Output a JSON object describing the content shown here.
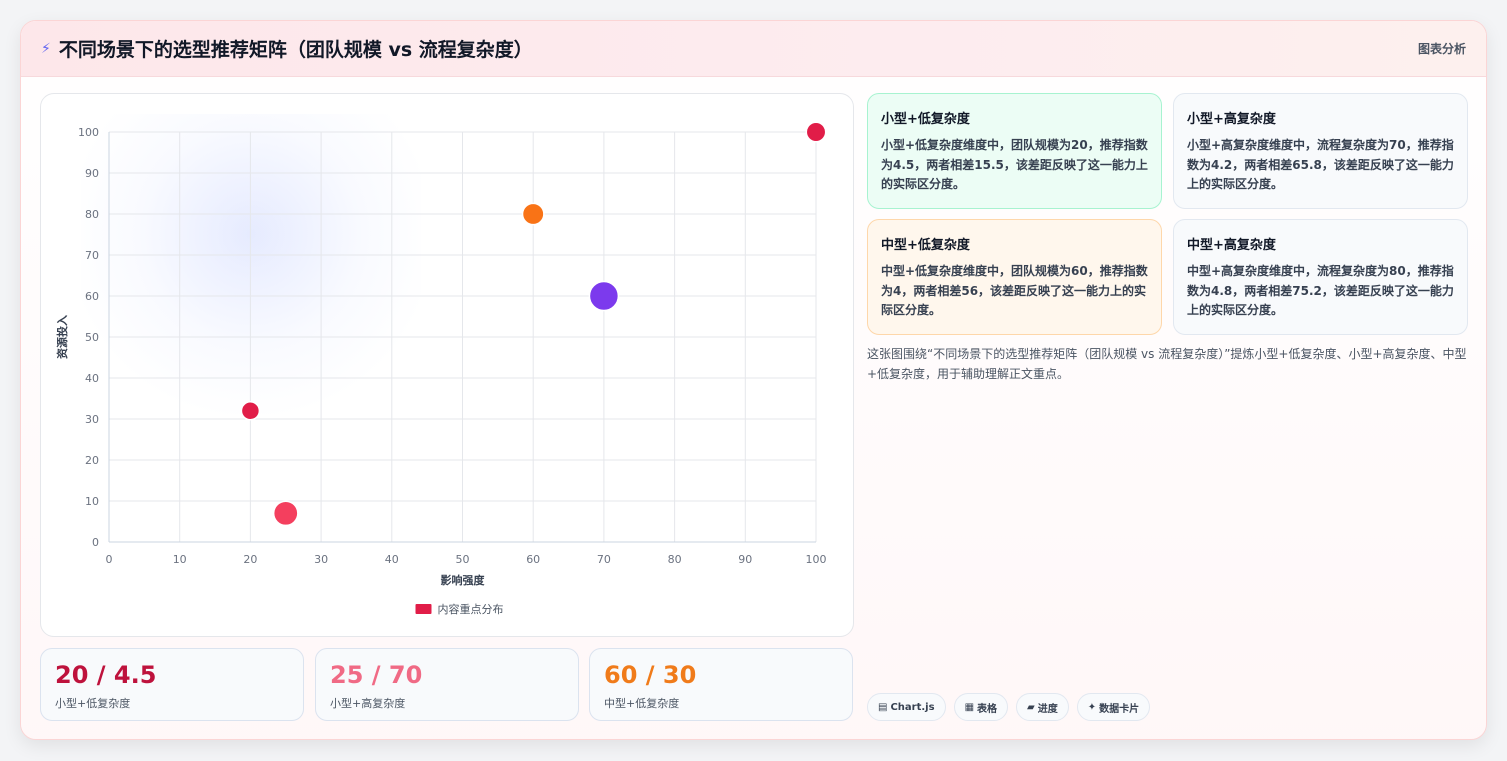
{
  "header": {
    "icon": "lightning-icon",
    "title": "不同场景下的选型推荐矩阵（团队规模 vs 流程复杂度）",
    "tag": "图表分析"
  },
  "chart_data": {
    "type": "scatter",
    "title": "",
    "xlabel": "影响强度",
    "ylabel": "资源投入",
    "xlim": [
      0,
      100
    ],
    "ylim": [
      0,
      100
    ],
    "x_ticks": [
      "0",
      "10",
      "20",
      "30",
      "40",
      "50",
      "60",
      "70",
      "80",
      "90",
      "100"
    ],
    "y_ticks": [
      "0",
      "10",
      "20",
      "30",
      "40",
      "50",
      "60",
      "70",
      "80",
      "90",
      "100"
    ],
    "grid": true,
    "legend": {
      "position": "bottom",
      "label": "内容重点分布",
      "color": "#e11d48"
    },
    "points": [
      {
        "x": 20,
        "y": 32,
        "size": 1,
        "color": "#e11d48"
      },
      {
        "x": 25,
        "y": 7,
        "size": 2,
        "color": "#f43f5e"
      },
      {
        "x": 60,
        "y": 80,
        "size": 1.5,
        "color": "#f97316"
      },
      {
        "x": 70,
        "y": 60,
        "size": 3,
        "color": "#7c3aed"
      },
      {
        "x": 100,
        "y": 100,
        "size": 1.2,
        "color": "#e11d48"
      }
    ]
  },
  "stats": [
    {
      "value": "20 / 4.5",
      "label": "小型+低复杂度",
      "color": "#be123c"
    },
    {
      "value": "25 / 70",
      "label": "小型+高复杂度",
      "color": "#f06a85"
    },
    {
      "value": "60 / 30",
      "label": "中型+低复杂度",
      "color": "#f07b1a"
    }
  ],
  "insights": [
    {
      "title": "小型+低复杂度",
      "text": "小型+低复杂度维度中，团队规模为20，推荐指数为4.5，两者相差15.5，该差距反映了这一能力上的实际区分度。",
      "bg": "#ecfdf5",
      "border": "#a7f3d0"
    },
    {
      "title": "小型+高复杂度",
      "text": "小型+高复杂度维度中，流程复杂度为70，推荐指数为4.2，两者相差65.8，该差距反映了这一能力上的实际区分度。",
      "bg": "#f8fafc",
      "border": "#e2e8f0"
    },
    {
      "title": "中型+低复杂度",
      "text": "中型+低复杂度维度中，团队规模为60，推荐指数为4，两者相差56，该差距反映了这一能力上的实际区分度。",
      "bg": "#fff7ed",
      "border": "#fed7aa"
    },
    {
      "title": "中型+高复杂度",
      "text": "中型+高复杂度维度中，流程复杂度为80，推荐指数为4.8，两者相差75.2，该差距反映了这一能力上的实际区分度。",
      "bg": "#f8fafc",
      "border": "#e2e8f0"
    }
  ],
  "summary": "这张图围绕“不同场景下的选型推荐矩阵（团队规模 vs 流程复杂度）”提炼小型+低复杂度、小型+高复杂度、中型+低复杂度，用于辅助理解正文重点。",
  "pills": [
    {
      "icon": "chart-icon",
      "glyph": "▤",
      "label": "Chart.js"
    },
    {
      "icon": "table-icon",
      "glyph": "▦",
      "label": "表格"
    },
    {
      "icon": "progress-icon",
      "glyph": "▰",
      "label": "进度"
    },
    {
      "icon": "sparkle-icon",
      "glyph": "✦",
      "label": "数据卡片"
    }
  ]
}
